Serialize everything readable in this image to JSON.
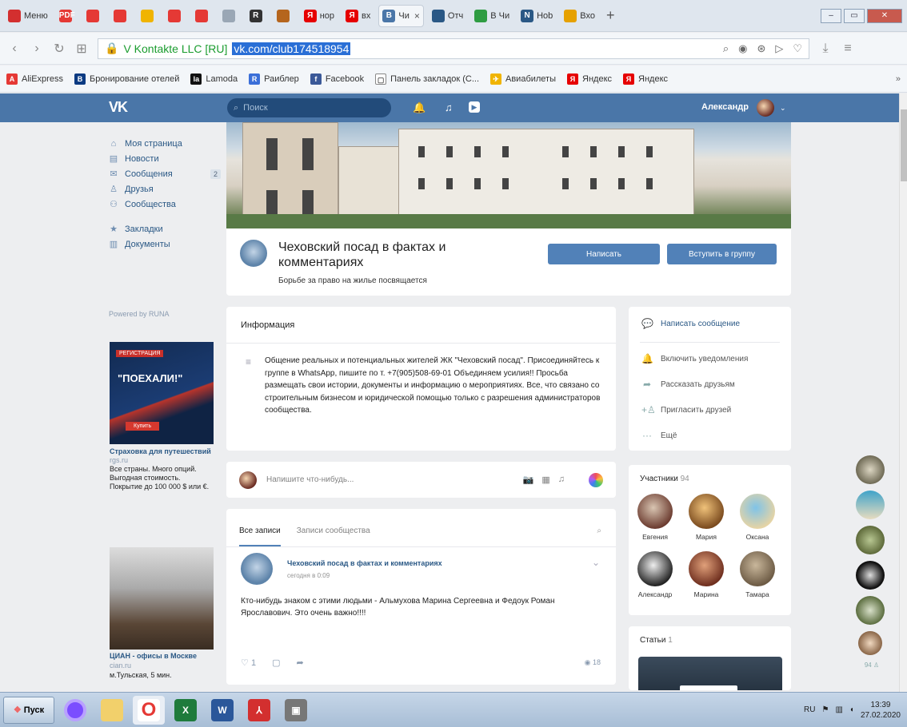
{
  "browser": {
    "tabs": [
      {
        "label": "Меню",
        "icon": "opera-menu-icon",
        "color": "#d32f2f"
      },
      {
        "label": "",
        "icon": "pdf-icon",
        "color": "#e53935",
        "text": "PDF"
      },
      {
        "label": "",
        "icon": "opera-icon",
        "color": "#e53935"
      },
      {
        "label": "",
        "icon": "opera-icon",
        "color": "#e53935"
      },
      {
        "label": "",
        "icon": "coin-icon",
        "color": "#f0b400"
      },
      {
        "label": "",
        "icon": "opera-icon",
        "color": "#e53935"
      },
      {
        "label": "",
        "icon": "opera-icon",
        "color": "#e53935"
      },
      {
        "label": "",
        "icon": "list-icon",
        "color": "#9aa7b5"
      },
      {
        "label": "",
        "icon": "r-icon",
        "color": "#333",
        "text": "R"
      },
      {
        "label": "",
        "icon": "figure-icon",
        "color": "#b5651d"
      },
      {
        "label": "нор",
        "icon": "yandex-icon",
        "color": "#e60000",
        "text": "Я"
      },
      {
        "label": "вх",
        "icon": "yandex-icon",
        "color": "#e60000",
        "text": "Я"
      },
      {
        "label": "Чи",
        "icon": "vk-icon",
        "color": "#4a76a8",
        "text": "В",
        "active": true
      },
      {
        "label": "Отч",
        "icon": "home-icon",
        "color": "#2a5885"
      },
      {
        "label": "В Чи",
        "icon": "chart-icon",
        "color": "#2e9c42"
      },
      {
        "label": "Ноb",
        "icon": "note-icon",
        "color": "#2a5885",
        "text": "N"
      },
      {
        "label": "Вхо",
        "icon": "mail-icon",
        "color": "#e6a100"
      }
    ],
    "new_tab": "+",
    "address": {
      "site_name": "V Kontakte LLC [RU]",
      "url": "vk.com/club174518954"
    },
    "bookmarks": [
      {
        "label": "AliExpress",
        "color": "#e53935",
        "text": "A"
      },
      {
        "label": "Бронирование отелей",
        "color": "#0c3b82",
        "text": "B"
      },
      {
        "label": "Lamoda",
        "color": "#111",
        "text": "la"
      },
      {
        "label": "Раиблер",
        "color": "#3b6fd8",
        "text": "R"
      },
      {
        "label": "Facebook",
        "color": "#3b5998",
        "text": "f"
      },
      {
        "label": "Панель закладок (С...",
        "color": "#ffffff",
        "text": "▢"
      },
      {
        "label": "Авиабилеты",
        "color": "#f0b400",
        "text": "✈"
      },
      {
        "label": "Яндекс",
        "color": "#e60000",
        "text": "Я"
      },
      {
        "label": "Яндекс",
        "color": "#e60000",
        "text": "Я"
      }
    ]
  },
  "vk": {
    "logo": "VK",
    "search_placeholder": "Поиск",
    "username": "Александр",
    "menu": [
      {
        "label": "Моя страница",
        "icon": "⌂"
      },
      {
        "label": "Новости",
        "icon": "▤"
      },
      {
        "label": "Сообщения",
        "icon": "✉",
        "badge": "2"
      },
      {
        "label": "Друзья",
        "icon": "♙"
      },
      {
        "label": "Сообщества",
        "icon": "⚇"
      }
    ],
    "menu2": [
      {
        "label": "Закладки",
        "icon": "★"
      },
      {
        "label": "Документы",
        "icon": "▥"
      }
    ],
    "powered": "Powered by RUNA",
    "ad1": {
      "badge": "РЕГИСТРАЦИЯ",
      "headline": "\"ПОЕХАЛИ!\"",
      "button": "Купить",
      "title": "Страховка для путешествий",
      "source": "rgs.ru",
      "text": "Все страны. Много опций. Выгодная стоимость. Покрытие до 100 000 $ или €."
    },
    "ad2": {
      "title": "ЦИАН - офисы в Москве",
      "source": "cian.ru",
      "text": "м.Тульская, 5 мин."
    },
    "group": {
      "name": "Чеховский посад в фактах и комментариях",
      "status": "Борьбе за право на жилье посвящается",
      "btn_write": "Написать",
      "btn_join": "Вступить в группу"
    },
    "info": {
      "heading": "Информация",
      "text": "Общение реальных и потенциальных жителей ЖК \"Чеховский посад\". Присоединяйтесь к группе в WhatsApp, пишите по т. +7(905)508-69-01 Объединяем усилия!! Просьба размещать свои истории, документы и информацию о мероприятиях. Все, что связано со строительным бизнесом и юридической помощью только с разрешения администраторов сообщества."
    },
    "actions": [
      {
        "label": "Написать сообщение",
        "icon": "💬",
        "primary": true
      },
      {
        "label": "Включить уведомления",
        "icon": "🔔"
      },
      {
        "label": "Рассказать друзьям",
        "icon": "➦"
      },
      {
        "label": "Пригласить друзей",
        "icon": "+♙"
      },
      {
        "label": "Ещё",
        "icon": "···"
      }
    ],
    "compose_placeholder": "Напишите что-нибудь...",
    "posts": {
      "tab_all": "Все записи",
      "tab_community": "Записи сообщества",
      "author": "Чеховский посад в фактах и комментариях",
      "time": "сегодня в 0:09",
      "text": "Кто-нибудь знаком с этими людьми - Альмухова Марина Сергеевна и Федоук Роман Ярославович. Это очень важно!!!!",
      "likes": "1",
      "views": "18"
    },
    "members": {
      "heading": "Участники",
      "count": "94",
      "list": [
        {
          "name": "Евгения",
          "c1": "#d9c5b2",
          "c2": "#6b3b2f"
        },
        {
          "name": "Мария",
          "c1": "#f0c27a",
          "c2": "#7a4a1e"
        },
        {
          "name": "Оксана",
          "c1": "#7fc3e8",
          "c2": "#e6d4a5"
        },
        {
          "name": "Александр",
          "c1": "#eeeeee",
          "c2": "#222222"
        },
        {
          "name": "Марина",
          "c1": "#e0a07a",
          "c2": "#6e2e1e"
        },
        {
          "name": "Тамара",
          "c1": "#c9b79b",
          "c2": "#6c5a44"
        }
      ]
    },
    "articles": {
      "heading": "Статьи",
      "count": "1"
    },
    "chat_count": "94 ♙"
  },
  "taskbar": {
    "start": "Пуск",
    "lang": "RU",
    "time": "13:39",
    "date": "27.02.2020"
  }
}
